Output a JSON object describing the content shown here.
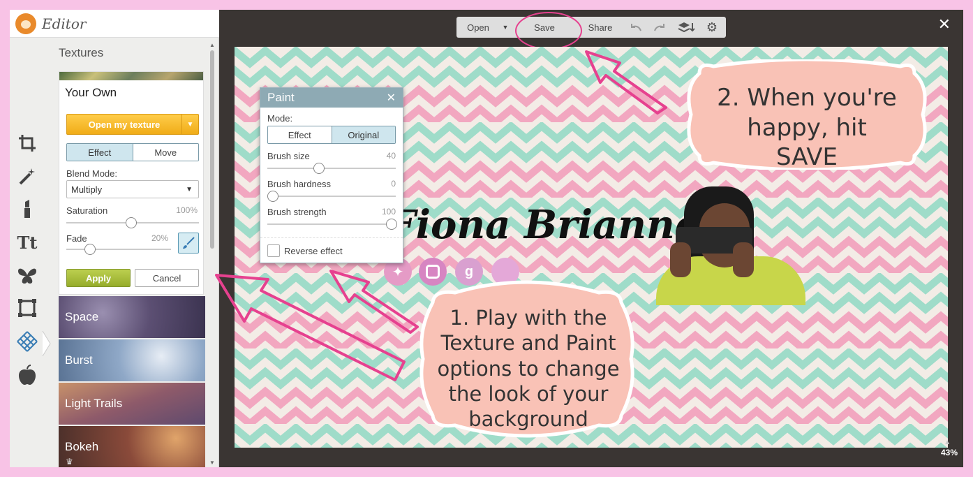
{
  "app": {
    "title": "Editor"
  },
  "sidebar": {
    "tools": [
      {
        "name": "crop-icon",
        "glyph": "⌗"
      },
      {
        "name": "magic-wand-icon",
        "glyph": "✦"
      },
      {
        "name": "lipstick-icon",
        "glyph": "▮"
      },
      {
        "name": "text-icon",
        "glyph": "Tt"
      },
      {
        "name": "butterfly-icon",
        "glyph": "❦"
      },
      {
        "name": "frame-icon",
        "glyph": "▢"
      },
      {
        "name": "texture-icon",
        "glyph": "▦"
      },
      {
        "name": "apple-icon",
        "glyph": "●"
      }
    ]
  },
  "textures": {
    "panel_title": "Textures",
    "card": {
      "name": "Your Own",
      "open_button": "Open my texture",
      "mode": {
        "effect": "Effect",
        "move": "Move",
        "selected": "Effect"
      },
      "blend_label": "Blend Mode:",
      "blend_value": "Multiply",
      "saturation_label": "Saturation",
      "saturation_value": "100%",
      "saturation_level": 1.0,
      "fade_label": "Fade",
      "fade_value": "20%",
      "fade_level": 0.2,
      "apply": "Apply",
      "cancel": "Cancel"
    },
    "list": [
      "Space",
      "Burst",
      "Light Trails",
      "Bokeh"
    ]
  },
  "toolbar": {
    "open": "Open",
    "save": "Save",
    "share": "Share"
  },
  "paint": {
    "title": "Paint",
    "mode_label": "Mode:",
    "effect": "Effect",
    "original": "Original",
    "selected": "Original",
    "brush_size_label": "Brush size",
    "brush_size": "40",
    "brush_hardness_label": "Brush hardness",
    "brush_hardness": "0",
    "brush_strength_label": "Brush strength",
    "brush_strength": "100",
    "reverse": "Reverse effect"
  },
  "canvas": {
    "name_text": "Fiona Brianne",
    "callout_save": "2. When you're happy, hit SAVE",
    "callout_texture": "1. Play with the Texture and Paint options to change the look of your background",
    "zoom": "43%"
  },
  "colors": {
    "frame": "#f8c3e6",
    "mint": "#9fdcc9",
    "pink": "#f2a7c0",
    "callout": "#f9c2b6",
    "arrow": "#e6418f"
  }
}
